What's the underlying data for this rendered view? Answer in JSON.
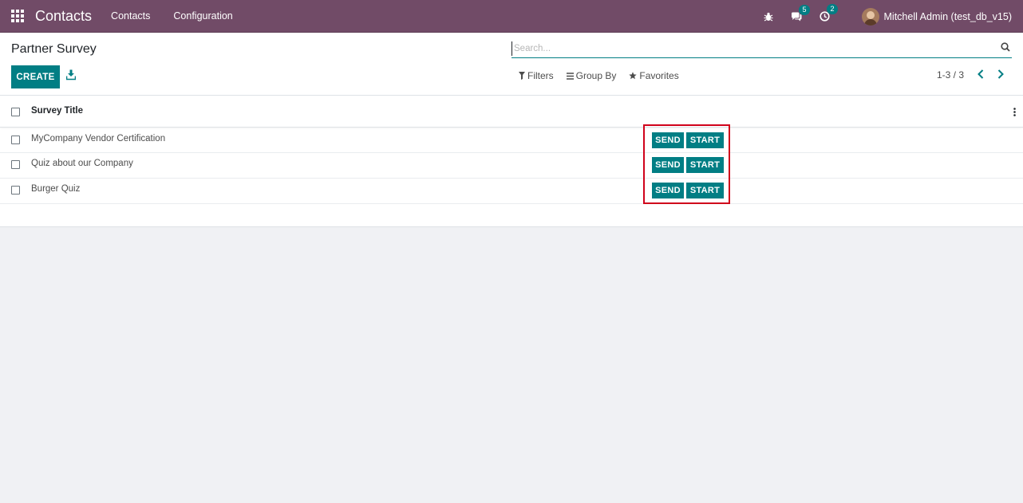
{
  "navbar": {
    "brand": "Contacts",
    "menu": [
      "Contacts",
      "Configuration"
    ],
    "messages_count": "5",
    "activities_count": "2",
    "user_name": "Mitchell Admin (test_db_v15)"
  },
  "control": {
    "title": "Partner Survey",
    "create_label": "CREATE",
    "search_placeholder": "Search...",
    "filters_label": "Filters",
    "groupby_label": "Group By",
    "favorites_label": "Favorites",
    "pager": "1-3 / 3"
  },
  "list": {
    "column_title": "Survey Title",
    "rows": [
      {
        "title": "MyCompany Vendor Certification",
        "send": "SEND",
        "start": "START"
      },
      {
        "title": "Quiz about our Company",
        "send": "SEND",
        "start": "START"
      },
      {
        "title": "Burger Quiz",
        "send": "SEND",
        "start": "START"
      }
    ]
  },
  "colors": {
    "navbar": "#714B67",
    "primary": "#017e84",
    "highlight": "#d0021b"
  }
}
